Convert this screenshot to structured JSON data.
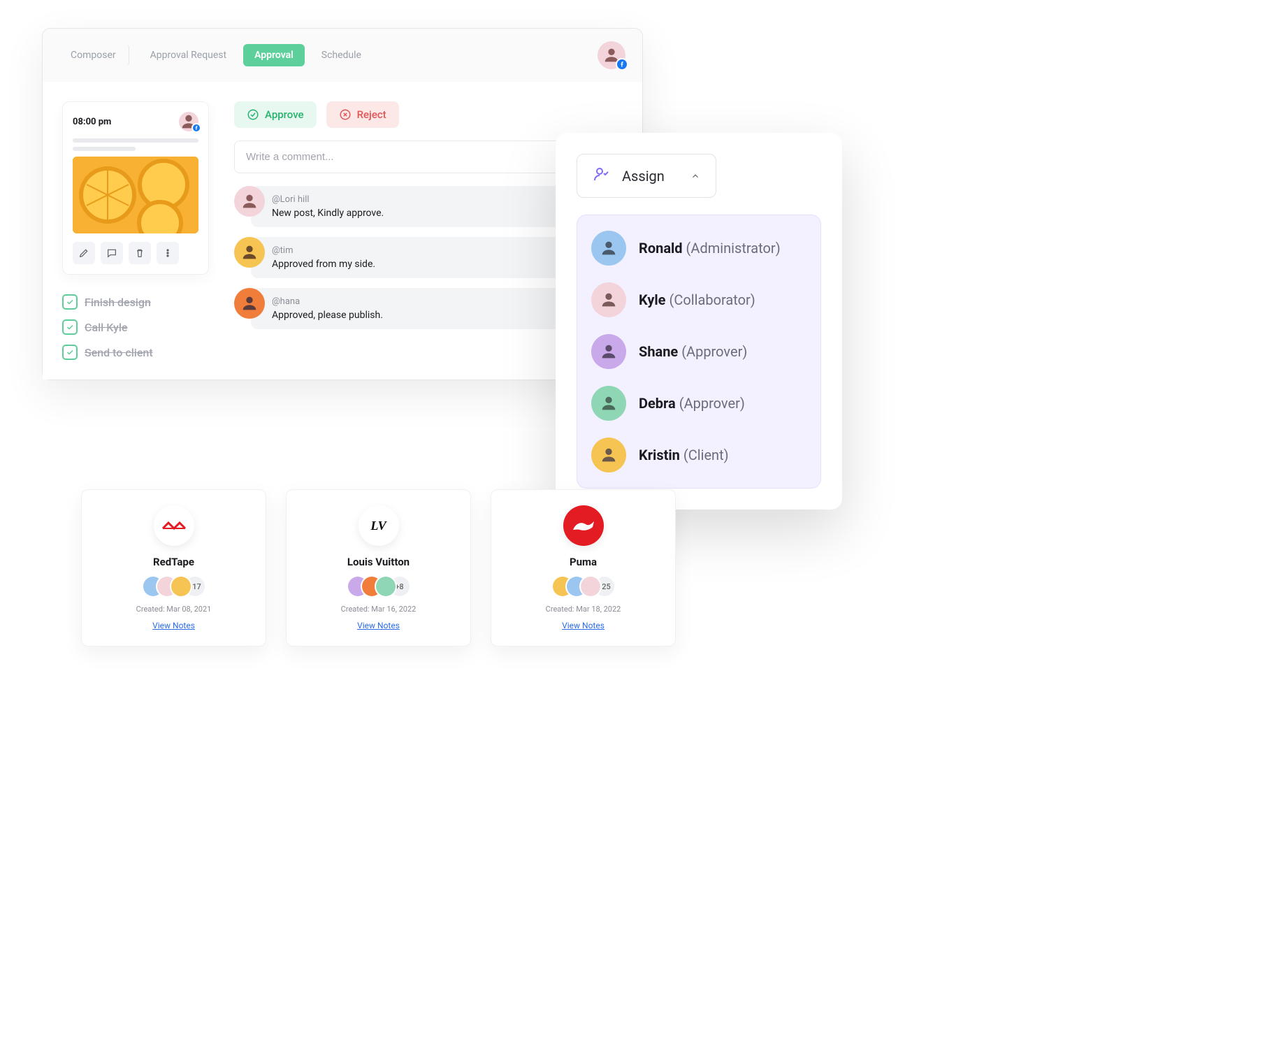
{
  "tabs": {
    "composer": "Composer",
    "approval_request": "Approval Request",
    "approval": "Approval",
    "schedule": "Schedule"
  },
  "post": {
    "time": "08:00 pm"
  },
  "actions": {
    "approve": "Approve",
    "reject": "Reject"
  },
  "comment_placeholder": "Write a comment...",
  "thread": [
    {
      "mention": "@Lori hill",
      "text": "New post, Kindly approve."
    },
    {
      "mention": "@tim",
      "text": "Approved from my side."
    },
    {
      "mention": "@hana",
      "text": "Approved, please publish."
    }
  ],
  "tasks": [
    {
      "label": "Finish design"
    },
    {
      "label": "Call Kyle"
    },
    {
      "label": "Send to client"
    }
  ],
  "assign": {
    "label": "Assign",
    "people": [
      {
        "name": "Ronald",
        "role": "(Administrator)"
      },
      {
        "name": "Kyle",
        "role": "(Collaborator)"
      },
      {
        "name": "Shane",
        "role": "(Approver)"
      },
      {
        "name": "Debra",
        "role": "(Approver)"
      },
      {
        "name": "Kristin",
        "role": "(Client)"
      }
    ]
  },
  "brands": [
    {
      "name": "RedTape",
      "extra": "+17",
      "created": "Created: Mar 08, 2021",
      "view": "View Notes"
    },
    {
      "name": "Louis Vuitton",
      "extra": "+8",
      "created": "Created: Mar 16, 2022",
      "view": "View Notes"
    },
    {
      "name": "Puma",
      "extra": "+25",
      "created": "Created: Mar 18, 2022",
      "view": "View Notes"
    }
  ]
}
